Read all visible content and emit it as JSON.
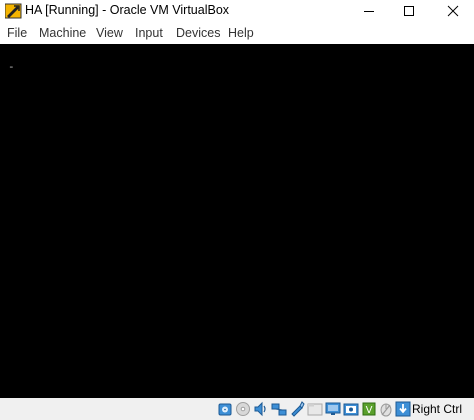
{
  "window": {
    "title": "HA [Running] - Oracle VM VirtualBox",
    "icon": "virtualbox-icon"
  },
  "menu": {
    "items": [
      "File",
      "Machine",
      "View",
      "Input",
      "Devices",
      "Help"
    ]
  },
  "screen": {
    "cursor_text": "-"
  },
  "statusbar": {
    "icons": [
      "hard-disk-icon",
      "optical-drive-icon",
      "audio-icon",
      "network-icon",
      "usb-icon",
      "shared-folders-icon",
      "display-icon",
      "video-capture-icon",
      "virtualization-icon",
      "mouse-integration-icon",
      "keyboard-capture-icon"
    ],
    "host_key_label": "Right Ctrl"
  },
  "colors": {
    "screen_bg": "#000000",
    "statusbar_bg": "#f0f0f0",
    "icon_blue": "#1f6fbf"
  }
}
